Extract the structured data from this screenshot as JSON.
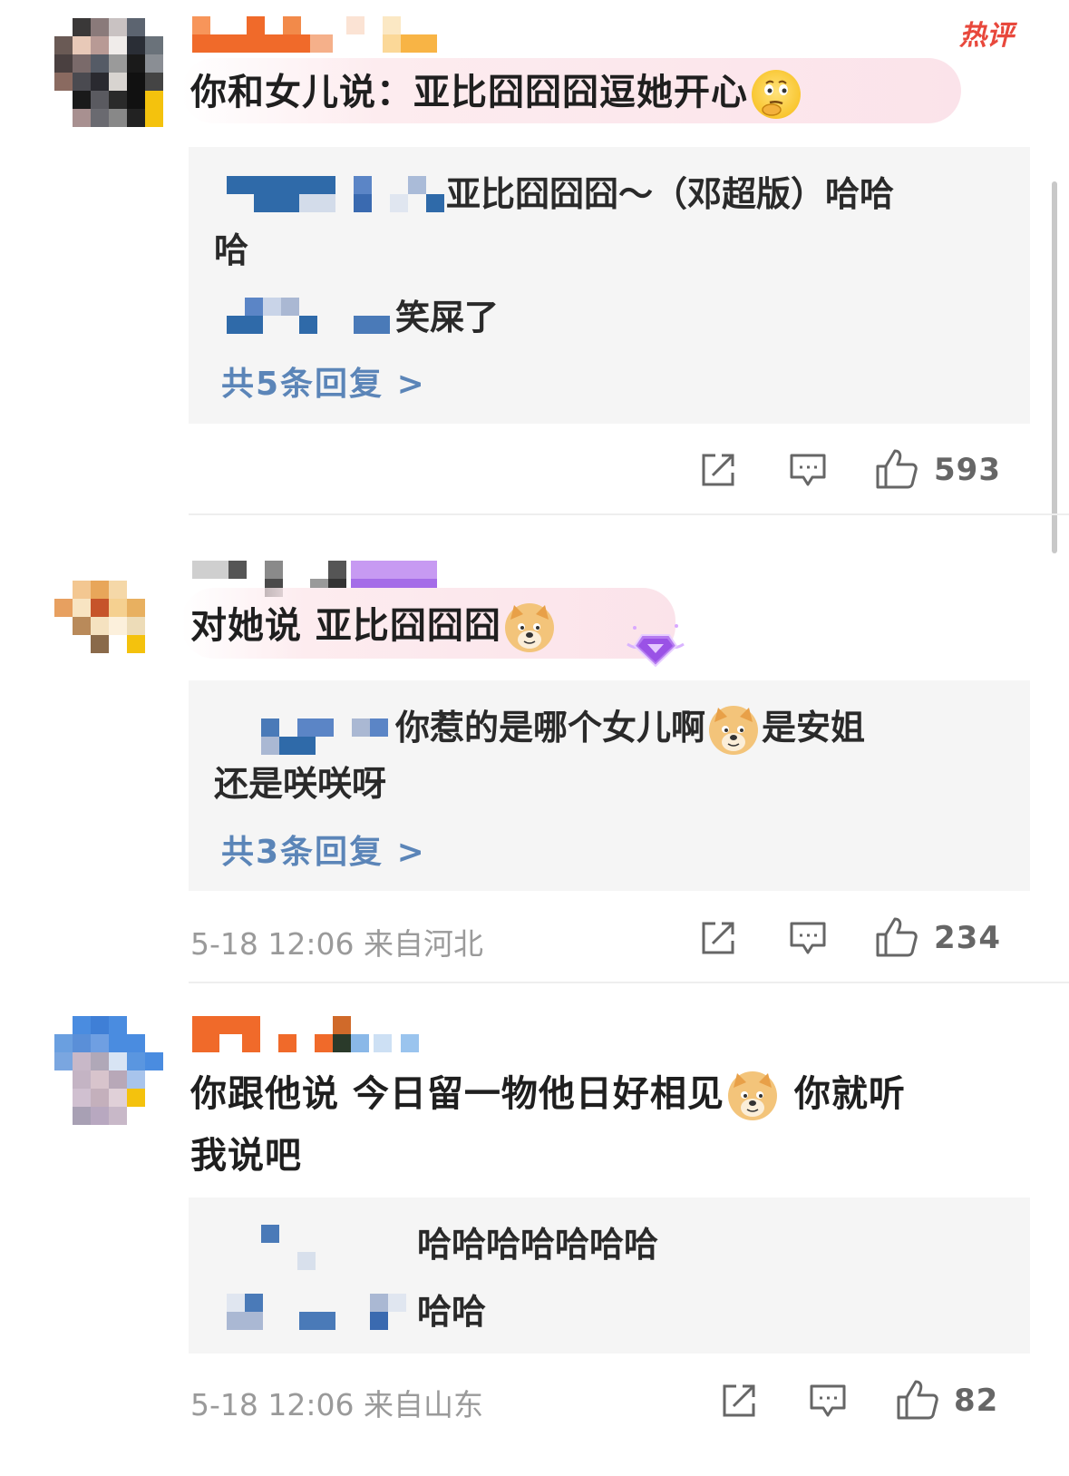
{
  "hot_badge": "热评",
  "comments": [
    {
      "text": "你和女儿说：亚比囧囧囧逗她开心",
      "emoji": "thinking-face-icon",
      "replies": [
        {
          "text_line1": "亚比囧囧囧～（邓超版）哈哈",
          "text_line2": "哈"
        },
        {
          "text_line1": "笑屎了"
        }
      ],
      "more_replies": "共5条回复 >",
      "meta": "",
      "likes": "593"
    },
    {
      "text": "对她说 亚比囧囧囧",
      "emoji": "doge-icon",
      "badge": "diamond-badge-icon",
      "replies": [
        {
          "text_line1": "你惹的是哪个女儿啊",
          "text_line1b": "是安姐",
          "text_line2": "还是咲咲呀"
        }
      ],
      "more_replies": "共3条回复 >",
      "meta": "5-18 12:06 来自河北",
      "likes": "234"
    },
    {
      "text_line1a": "你跟他说 今日留一物他日好相见",
      "text_line1b": "你就听",
      "text_line2": "我说吧",
      "emoji": "doge-icon",
      "replies": [
        {
          "text_line1": "哈哈哈哈哈哈哈"
        },
        {
          "text_line1": "哈哈"
        }
      ],
      "meta": "5-18 12:06 来自山东",
      "likes": "82"
    }
  ],
  "colors": {
    "reply_link": "#5b85b8",
    "reply_bg": "#f5f5f5",
    "meta_gray": "#9a9a9a",
    "hot_red": "#e8483c"
  }
}
